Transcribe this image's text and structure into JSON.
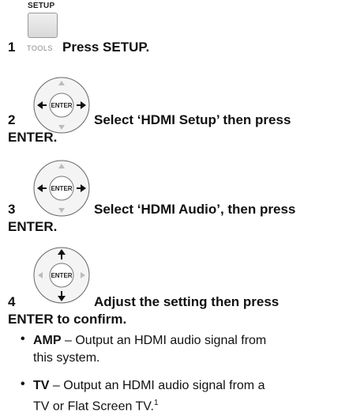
{
  "steps": [
    {
      "number": "1",
      "key_label_top": "SETUP",
      "key_label_side": "TOOLS",
      "text": "Press SETUP."
    },
    {
      "number": "2",
      "key_label": "ENTER",
      "text_line1": "Select ‘HDMI Setup’ then press",
      "text_line2": "ENTER."
    },
    {
      "number": "3",
      "key_label": "ENTER",
      "text_line1": "Select ‘HDMI Audio’, then press",
      "text_line2": "ENTER."
    },
    {
      "number": "4",
      "key_label": "ENTER",
      "text_line1": "Adjust the setting then press",
      "text_line2": "ENTER to confirm."
    }
  ],
  "options": [
    {
      "term": "AMP",
      "desc_line1": " – Output an HDMI audio signal from",
      "desc_line2": "this system."
    },
    {
      "term": "TV",
      "desc_line1": " – Output an HDMI audio signal from a",
      "desc_line2": "TV or Flat Screen TV.",
      "footnote": "1"
    }
  ]
}
